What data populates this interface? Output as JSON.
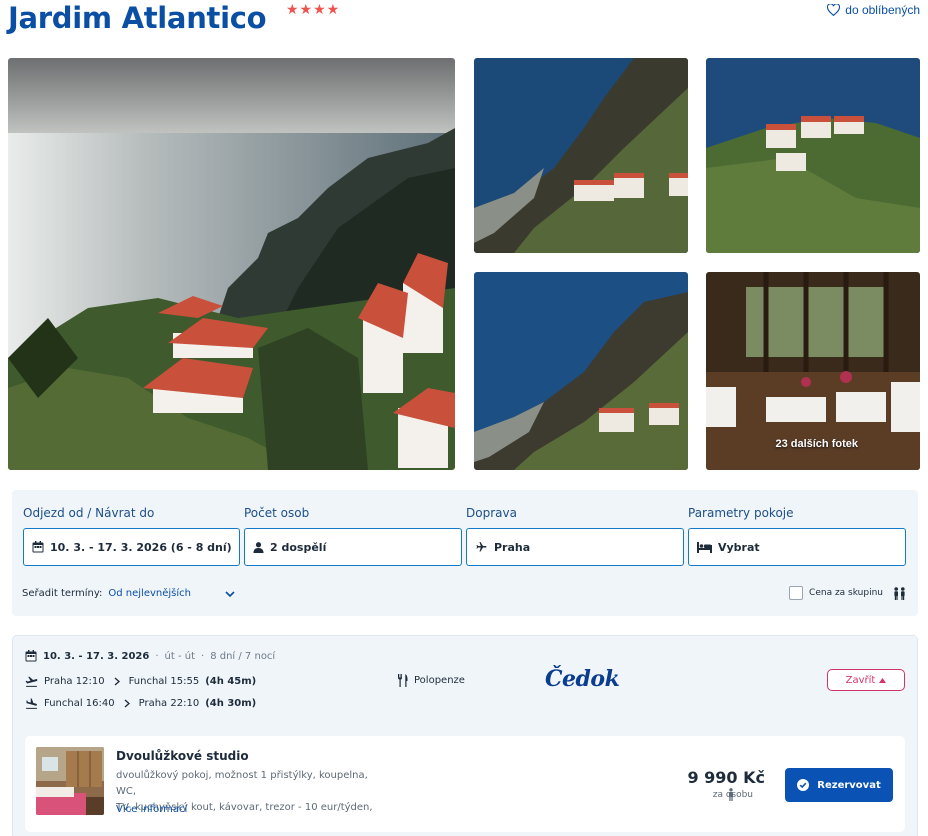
{
  "header": {
    "title": "Jardim Atlantico",
    "stars": "★★★★",
    "favorite_label": "do oblíbených"
  },
  "gallery": {
    "more_label": "23 dalších fotek"
  },
  "filters": {
    "dates": {
      "label": "Odjezd od / Návrat do",
      "value": "10. 3. - 17. 3. 2026 (6 - 8 dní)"
    },
    "people": {
      "label": "Počet osob",
      "value": "2 dospělí"
    },
    "transport": {
      "label": "Doprava",
      "value": "Praha"
    },
    "room": {
      "label": "Parametry pokoje",
      "value": "Vybrat"
    },
    "sort_label": "Seřadit termíny:",
    "sort_value": "Od nejlevnějších",
    "group_price_label": "Cena za skupinu"
  },
  "result": {
    "dates": "10. 3. - 17. 3. 2026",
    "days": "út - út",
    "duration": "8 dní / 7 nocí",
    "outbound": {
      "from": "Praha 12:10",
      "to": "Funchal 15:55",
      "length": "(4h 45m)"
    },
    "inbound": {
      "from": "Funchal 16:40",
      "to": "Praha 22:10",
      "length": "(4h 30m)"
    },
    "board": "Polopenze",
    "operator": "Čedok",
    "close_label": "Zavřít",
    "room": {
      "name": "Dvoulůžkové studio",
      "desc_line1": "dvoulůžkový pokoj, možnost 1 přistýlky, koupelna, WC,",
      "desc_line2": "TV, kuchyňský kout, kávovar, trezor - 10 eur/týden,",
      "more_info": "Více informací",
      "price": "9 990 Kč",
      "per_person": "za osobu",
      "book_label": "Rezervovat"
    }
  },
  "colors": {
    "brand": "#0a4fa3",
    "accent_star": "#ef5350",
    "close_button": "#d6336c",
    "book_button": "#0a52b3"
  }
}
